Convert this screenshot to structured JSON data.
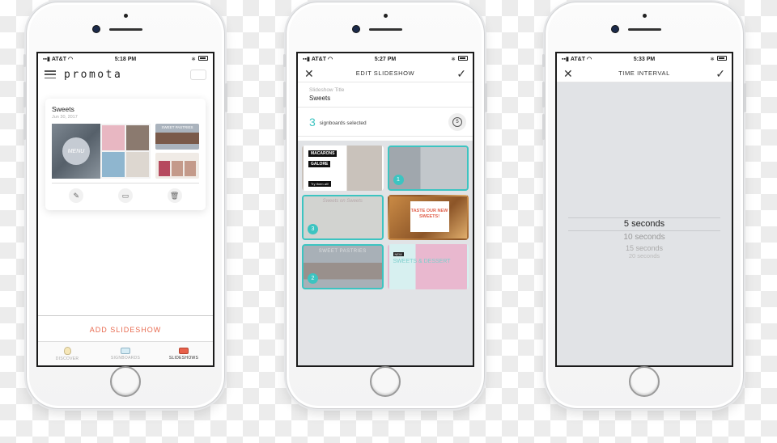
{
  "phones": [
    {
      "status": {
        "carrier": "AT&T",
        "time": "5:18 PM"
      },
      "app_logo": "promota",
      "slideshow_card": {
        "title": "Sweets",
        "date": "Jun 30, 2017",
        "thumb_main_label": "MENU",
        "thumb_side_1_label": "SWEET PASTRIES",
        "actions": [
          "edit",
          "cast",
          "delete"
        ]
      },
      "add_slideshow_label": "ADD SLIDESHOW",
      "tabs": [
        {
          "label": "DISCOVER",
          "icon": "lightbulb-icon",
          "active": false
        },
        {
          "label": "SIGNBOARDS",
          "icon": "signboard-icon",
          "active": false
        },
        {
          "label": "SLIDESHOWS",
          "icon": "slideshow-icon",
          "active": true
        }
      ]
    },
    {
      "status": {
        "carrier": "AT&T",
        "time": "5:27 PM"
      },
      "nav_title": "EDIT SLIDESHOW",
      "title_field": {
        "label": "Slideshow Title",
        "value": "Sweets"
      },
      "selected_count": "3",
      "selected_text": "signboards selected",
      "timer_value": "5",
      "signboards": [
        {
          "name": "macarons",
          "text_1": "MACARONS",
          "text_2": "GALORE",
          "text_3": "Try them all!",
          "selected": false,
          "order": ""
        },
        {
          "name": "menu",
          "selected": true,
          "order": "1"
        },
        {
          "name": "sweets-on-sweets",
          "text_1": "Sweets on Sweets",
          "selected": true,
          "order": "3"
        },
        {
          "name": "taste-new-sweets",
          "text_1": "TASTE OUR NEW SWEETS!",
          "selected": false,
          "order": ""
        },
        {
          "name": "sweet-pastries",
          "text_1": "SWEET PASTRIES",
          "selected": true,
          "order": "2"
        },
        {
          "name": "sweets-dessert",
          "text_1": "NEW",
          "text_2": "SWEETS & DESSERT",
          "selected": false,
          "order": ""
        }
      ],
      "accent_color": "#3cc4c1"
    },
    {
      "status": {
        "carrier": "AT&T",
        "time": "5:33 PM"
      },
      "nav_title": "TIME INTERVAL",
      "picker": {
        "selected": "5 seconds",
        "options": [
          "10 seconds",
          "15 seconds",
          "20 seconds"
        ]
      }
    }
  ],
  "colors": {
    "accent_teal": "#3cc4c1",
    "accent_orange": "#e86b50"
  }
}
